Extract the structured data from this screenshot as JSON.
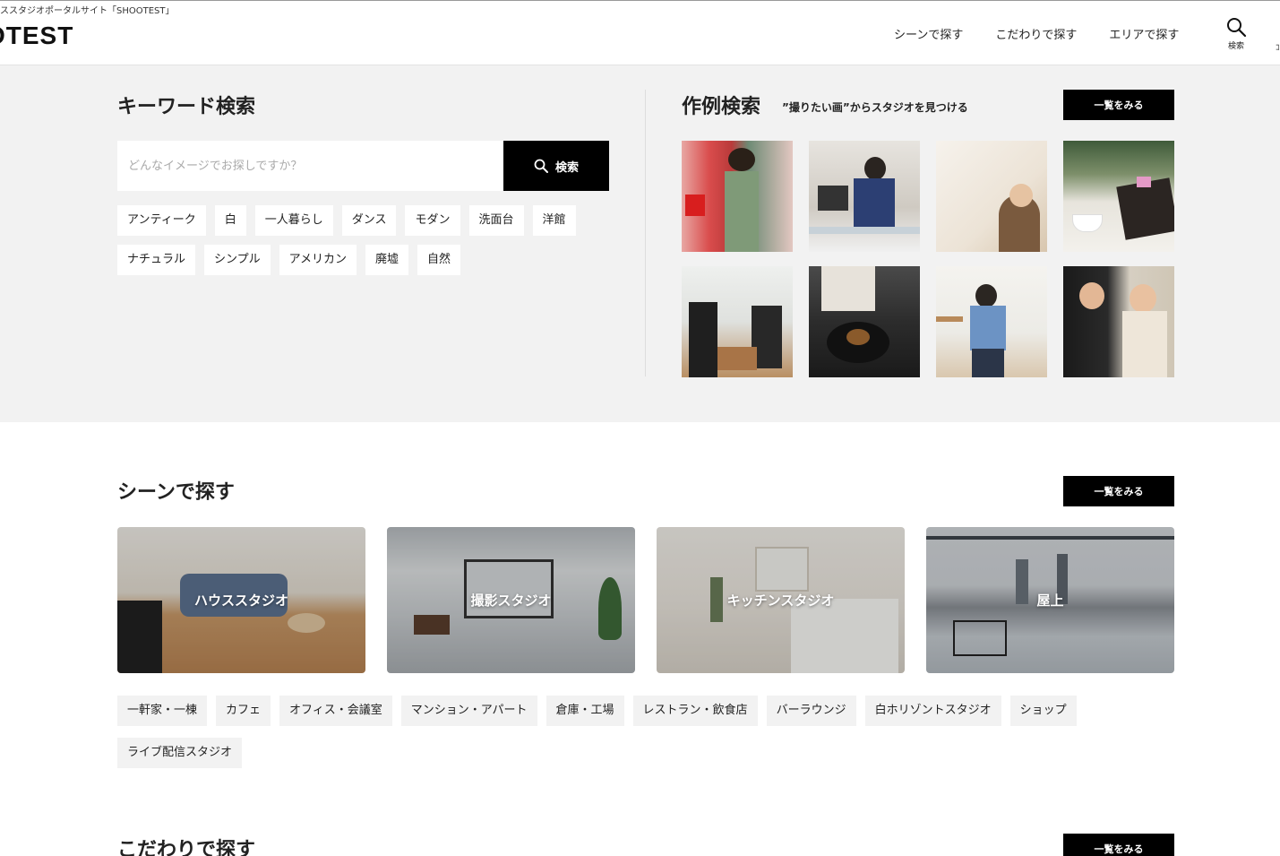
{
  "header": {
    "tagline": "ススタジオポータルサイト「SHOOTEST」",
    "logo": "OTEST",
    "nav": [
      "シーンで探す",
      "こだわりで探す",
      "エリアで探す"
    ],
    "search_label": "検索"
  },
  "keyword_search": {
    "title": "キーワード検索",
    "placeholder": "どんなイメージでお探しですか？",
    "submit_label": "検索",
    "tags": [
      "アンティーク",
      "白",
      "一人暮らし",
      "ダンス",
      "モダン",
      "洗面台",
      "洋館",
      "ナチュラル",
      "シンプル",
      "アメリカン",
      "廃墟",
      "自然"
    ]
  },
  "example_search": {
    "title": "作例検索",
    "subtitle": "”撮りたい画”からスタジオを見つける",
    "more_label": "一覧をみる"
  },
  "scene": {
    "title": "シーンで探す",
    "more_label": "一覧をみる",
    "cards": [
      "ハウススタジオ",
      "撮影スタジオ",
      "キッチンスタジオ",
      "屋上"
    ],
    "tags": [
      "一軒家・一棟",
      "カフェ",
      "オフィス・会議室",
      "マンション・アパート",
      "倉庫・工場",
      "レストラン・飲食店",
      "バーラウンジ",
      "白ホリゾントスタジオ",
      "ショップ",
      "ライブ配信スタジオ"
    ]
  },
  "kodawari": {
    "title": "こだわりで探す",
    "more_label": "一覧をみる"
  }
}
